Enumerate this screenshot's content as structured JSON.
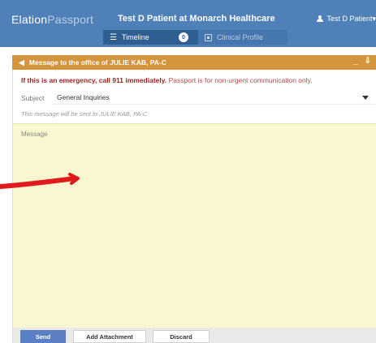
{
  "app": {
    "logo_main": "Elation",
    "logo_light": "Passport",
    "page_title": "Test D Patient at Monarch Healthcare",
    "user_name": "Test D Patient"
  },
  "tabs": [
    {
      "label": "Timeline",
      "icon": "list-icon",
      "badge": "0",
      "active": true
    },
    {
      "label": "Clinical Profile",
      "icon": "clinical-profile-icon",
      "active": false
    }
  ],
  "panel": {
    "title": "Message to the office of JULIE KAB, PA-C",
    "emergency_bold": "If this is an emergency, call 911 immediately.",
    "emergency_note": "Passport is for non-urgent communication only.",
    "subject_label": "Subject",
    "subject_value": "General Inquiries",
    "recipient_note": "This message will be sent to JULIE KAB, PA-C",
    "message_placeholder": "Message"
  },
  "buttons": {
    "send": "Send",
    "attach": "Add Attachment",
    "discard": "Discard"
  },
  "colors": {
    "topbar": "#4f80b8",
    "panel_header": "#d4943c",
    "message_bg": "#f9f7cf",
    "send_button": "#5b7fc4",
    "annotation": "#e01b1b"
  }
}
